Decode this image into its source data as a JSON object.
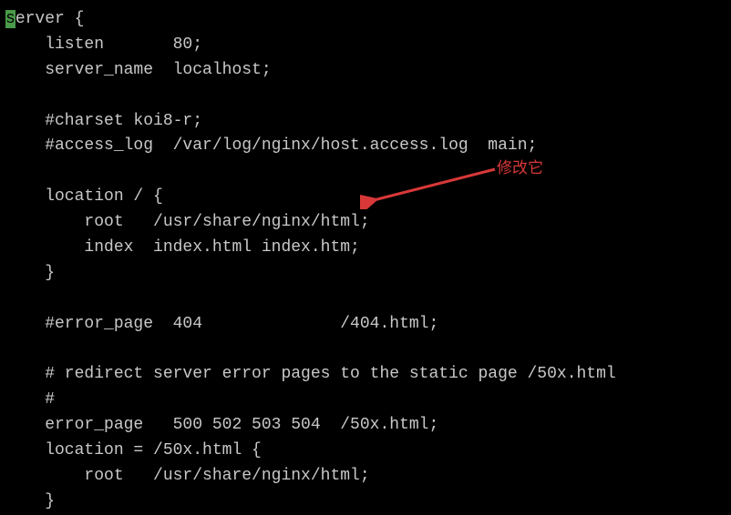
{
  "code": {
    "lines": [
      "server {",
      "    listen       80;",
      "    server_name  localhost;",
      "",
      "    #charset koi8-r;",
      "    #access_log  /var/log/nginx/host.access.log  main;",
      "",
      "    location / {",
      "        root   /usr/share/nginx/html;",
      "        index  index.html index.htm;",
      "    }",
      "",
      "    #error_page  404              /404.html;",
      "",
      "    # redirect server error pages to the static page /50x.html",
      "    #",
      "    error_page   500 502 503 504  /50x.html;",
      "    location = /50x.html {",
      "        root   /usr/share/nginx/html;",
      "    }"
    ],
    "cursor_line": 0,
    "cursor_col": 0
  },
  "annotation": {
    "label": "修改它"
  }
}
